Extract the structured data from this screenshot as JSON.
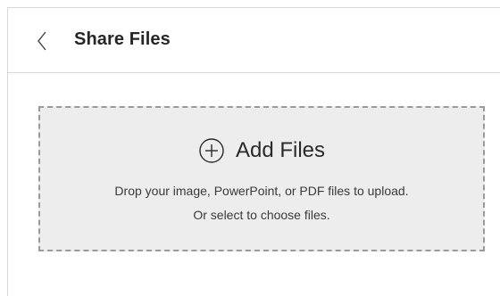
{
  "header": {
    "title": "Share Files",
    "back_icon": "chevron-left-icon"
  },
  "dropzone": {
    "add_label": "Add Files",
    "add_icon": "plus-circle-icon",
    "hint_line1": "Drop your image, PowerPoint, or PDF files to upload.",
    "hint_line2": "Or select to choose files."
  },
  "colors": {
    "border": "#d9d9d9",
    "dropzone_bg": "#ededed",
    "dropzone_border": "#9a9a9a",
    "text": "#262626"
  }
}
